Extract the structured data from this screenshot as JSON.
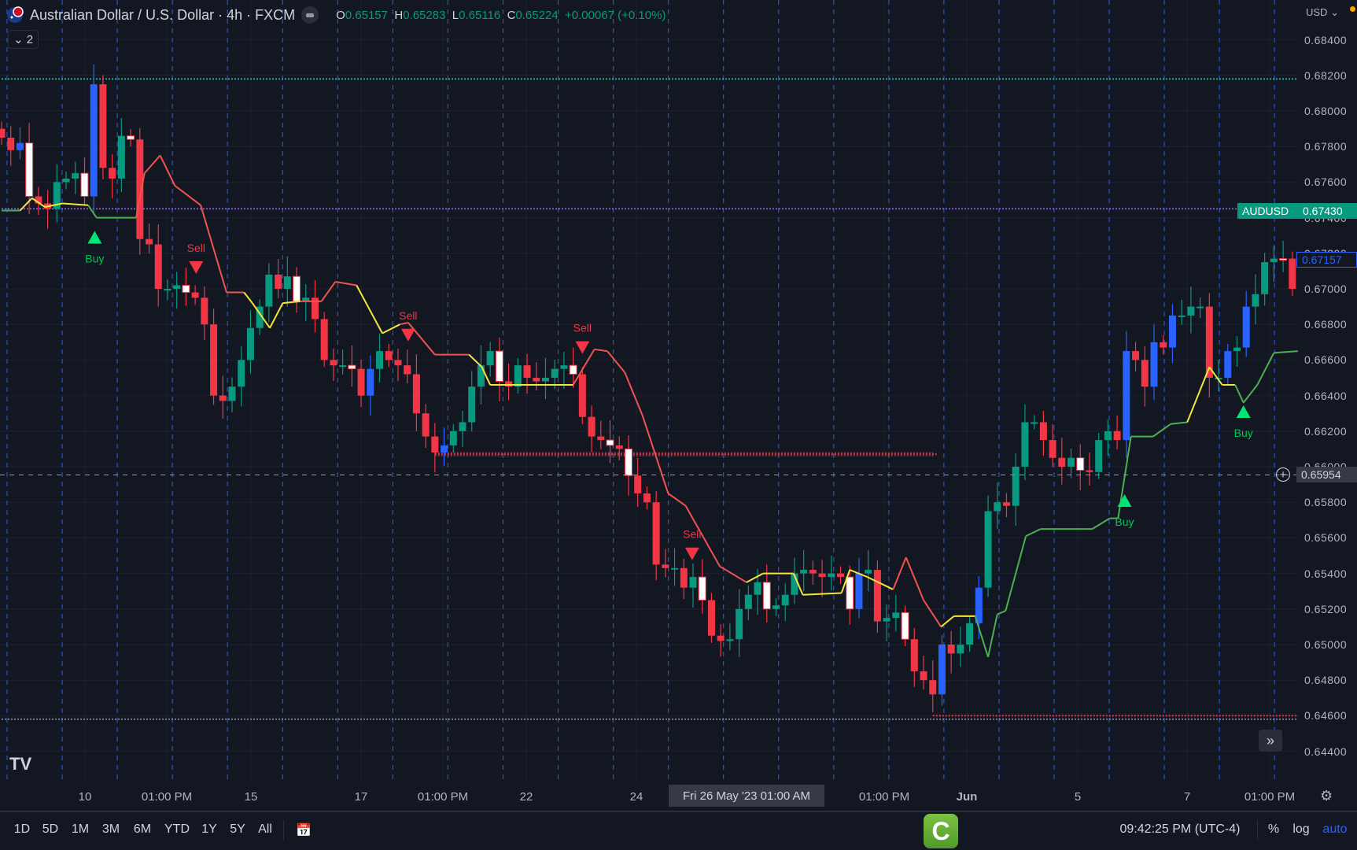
{
  "header": {
    "title": "Australian Dollar / U.S. Dollar · 4h · FXCM",
    "o_label": "O",
    "o": "0.65157",
    "h_label": "H",
    "h": "0.65283",
    "l_label": "L",
    "l": "0.65116",
    "c_label": "C",
    "c": "0.65224",
    "change": "+0.00067 (+0.10%)",
    "indicators_count": "2"
  },
  "axis": {
    "currency": "USD",
    "ticks": [
      "0.68400",
      "0.68200",
      "0.68000",
      "0.67800",
      "0.67600",
      "0.67400",
      "0.67200",
      "0.67000",
      "0.66800",
      "0.66600",
      "0.66400",
      "0.66200",
      "0.66000",
      "0.65800",
      "0.65600",
      "0.65400",
      "0.65200",
      "0.65000",
      "0.64800",
      "0.64600",
      "0.64400"
    ],
    "symbol_tag": "AUDUSD",
    "symbol_price": "0.67430",
    "last_price": "0.67157",
    "crosshair_price": "0.65954"
  },
  "time_labels": [
    "10",
    "01:00 PM",
    "15",
    "17",
    "01:00 PM",
    "22",
    "24",
    "01:00 PM",
    "Jun",
    "5",
    "7",
    "01:00 PM"
  ],
  "crosshair_time": "Fri 26 May '23  01:00 AM",
  "toolbar": {
    "ranges": [
      "1D",
      "5D",
      "1M",
      "3M",
      "6M",
      "YTD",
      "1Y",
      "5Y",
      "All"
    ],
    "clock": "09:42:25 PM (UTC-4)",
    "percent": "%",
    "log": "log",
    "auto": "auto",
    "center_logo": "C"
  },
  "logo": "17",
  "colors": {
    "bull": "#089981",
    "bear": "#f23645",
    "blue": "#2962ff",
    "white": "#ffffff",
    "trail_red": "#f05350",
    "trail_yellow": "#f5e63b",
    "trail_green": "#4caf50"
  },
  "chart_data": {
    "type": "candlestick",
    "start_open": 0.679,
    "closes": [
      [
        0.6785
      ],
      [
        0.6778
      ],
      [
        0.6782,
        "b"
      ],
      [
        0.6752,
        "w"
      ],
      [
        0.6748
      ],
      [
        0.6745
      ],
      [
        0.676
      ],
      [
        0.6762
      ],
      [
        0.6765
      ],
      [
        0.6752,
        "w"
      ],
      [
        0.6815,
        "b"
      ],
      [
        0.6768
      ],
      [
        0.6762
      ],
      [
        0.6786
      ],
      [
        0.6784,
        "w"
      ],
      [
        0.6728
      ],
      [
        0.6725
      ],
      [
        0.67
      ],
      [
        0.67
      ],
      [
        0.6702
      ],
      [
        0.6698,
        "w"
      ],
      [
        0.6695
      ],
      [
        0.668
      ],
      [
        0.664
      ],
      [
        0.6637
      ],
      [
        0.6645
      ],
      [
        0.666
      ],
      [
        0.6678
      ],
      [
        0.669
      ],
      [
        0.6708
      ],
      [
        0.67
      ],
      [
        0.6707
      ],
      [
        0.6693,
        "w"
      ],
      [
        0.6695
      ],
      [
        0.6683
      ],
      [
        0.666
      ],
      [
        0.6657
      ],
      [
        0.6657
      ],
      [
        0.6655,
        "w"
      ],
      [
        0.664
      ],
      [
        0.6655,
        "b"
      ],
      [
        0.6665
      ],
      [
        0.666
      ],
      [
        0.6657
      ],
      [
        0.6652
      ],
      [
        0.663
      ],
      [
        0.6617
      ],
      [
        0.6608
      ],
      [
        0.6612,
        "b"
      ],
      [
        0.662
      ],
      [
        0.6625
      ],
      [
        0.6645
      ],
      [
        0.6657
      ],
      [
        0.6665
      ],
      [
        0.6648,
        "w"
      ],
      [
        0.6645
      ],
      [
        0.6657
      ],
      [
        0.665
      ],
      [
        0.6648
      ],
      [
        0.665
      ],
      [
        0.6655
      ],
      [
        0.6657
      ],
      [
        0.6652,
        "w"
      ],
      [
        0.6628
      ],
      [
        0.6617
      ],
      [
        0.6615
      ],
      [
        0.6612,
        "w"
      ],
      [
        0.661
      ],
      [
        0.6595,
        "w"
      ],
      [
        0.6585
      ],
      [
        0.658
      ],
      [
        0.6545
      ],
      [
        0.6543
      ],
      [
        0.6543
      ],
      [
        0.6532
      ],
      [
        0.6538
      ],
      [
        0.6525,
        "w"
      ],
      [
        0.6505
      ],
      [
        0.6502
      ],
      [
        0.6503
      ],
      [
        0.652
      ],
      [
        0.6528
      ],
      [
        0.6535
      ],
      [
        0.652,
        "w"
      ],
      [
        0.6522
      ],
      [
        0.6528
      ],
      [
        0.654
      ],
      [
        0.6542
      ],
      [
        0.654
      ],
      [
        0.6538
      ],
      [
        0.654
      ],
      [
        0.6538
      ],
      [
        0.652,
        "w"
      ],
      [
        0.654,
        "b"
      ],
      [
        0.6542
      ],
      [
        0.6513
      ],
      [
        0.6515
      ],
      [
        0.6518
      ],
      [
        0.6503,
        "w"
      ],
      [
        0.6485
      ],
      [
        0.648
      ],
      [
        0.6472
      ],
      [
        0.65,
        "b"
      ],
      [
        0.6495
      ],
      [
        0.65
      ],
      [
        0.6512
      ],
      [
        0.6532,
        "b"
      ],
      [
        0.6575
      ],
      [
        0.658
      ],
      [
        0.6578
      ],
      [
        0.66
      ],
      [
        0.6625
      ],
      [
        0.6625
      ],
      [
        0.6615
      ],
      [
        0.6605
      ],
      [
        0.66
      ],
      [
        0.6605
      ],
      [
        0.6598,
        "w"
      ],
      [
        0.6597
      ],
      [
        0.6615
      ],
      [
        0.662
      ],
      [
        0.6615
      ],
      [
        0.6665,
        "b"
      ],
      [
        0.666
      ],
      [
        0.6645
      ],
      [
        0.667,
        "b"
      ],
      [
        0.6667
      ],
      [
        0.6685,
        "b"
      ],
      [
        0.6685
      ],
      [
        0.669
      ],
      [
        0.669
      ],
      [
        0.665
      ],
      [
        0.665
      ],
      [
        0.6665,
        "b"
      ],
      [
        0.6667
      ],
      [
        0.669,
        "b"
      ],
      [
        0.6697
      ],
      [
        0.6715
      ],
      [
        0.6717
      ],
      [
        0.6717,
        "w"
      ],
      [
        0.67
      ],
      [
        0.67157,
        "b"
      ]
    ],
    "trail": [
      [
        0,
        0.6744,
        "g"
      ],
      [
        2,
        0.6744,
        "y"
      ],
      [
        3.3,
        0.6751,
        "y"
      ],
      [
        4.7,
        0.6746,
        "y"
      ],
      [
        6.6,
        0.6748,
        "y"
      ],
      [
        9.4,
        0.6747,
        "g"
      ],
      [
        10.3,
        0.674,
        "g"
      ],
      [
        14.6,
        0.674,
        "r"
      ],
      [
        15.5,
        0.6765,
        "r"
      ],
      [
        17.2,
        0.6775,
        "r"
      ],
      [
        18.8,
        0.6758,
        "r"
      ],
      [
        21.6,
        0.6747,
        "r"
      ],
      [
        24.4,
        0.6698,
        "r"
      ],
      [
        26.3,
        0.6698,
        "y"
      ],
      [
        27.2,
        0.6692,
        "y"
      ],
      [
        29.1,
        0.6678,
        "y"
      ],
      [
        30.5,
        0.6692,
        "y"
      ],
      [
        32.4,
        0.6693,
        "r"
      ],
      [
        34.7,
        0.6693,
        "r"
      ],
      [
        36.2,
        0.6704,
        "r"
      ],
      [
        38.5,
        0.6702,
        "y"
      ],
      [
        41.3,
        0.6675,
        "y"
      ],
      [
        43.2,
        0.668,
        "r"
      ],
      [
        44.1,
        0.6681,
        "r"
      ],
      [
        47,
        0.6663,
        "r"
      ],
      [
        50.7,
        0.6663,
        "y"
      ],
      [
        52.1,
        0.6656,
        "y"
      ],
      [
        53,
        0.6646,
        "y"
      ],
      [
        62,
        0.6646,
        "r"
      ],
      [
        64.3,
        0.6666,
        "r"
      ],
      [
        65.7,
        0.6665,
        "r"
      ],
      [
        67.6,
        0.6653,
        "r"
      ],
      [
        69.5,
        0.6629,
        "r"
      ],
      [
        72.3,
        0.6585,
        "r"
      ],
      [
        74.2,
        0.6578,
        "r"
      ],
      [
        77.9,
        0.6544,
        "r"
      ],
      [
        80.8,
        0.6535,
        "y"
      ],
      [
        82.6,
        0.654,
        "y"
      ],
      [
        85.9,
        0.654,
        "y"
      ],
      [
        86.9,
        0.6528,
        "y"
      ],
      [
        91.1,
        0.6529,
        "y"
      ],
      [
        92,
        0.6542,
        "y"
      ],
      [
        93.9,
        0.6538,
        "y"
      ],
      [
        96.7,
        0.6531,
        "r"
      ],
      [
        98.1,
        0.6549,
        "r"
      ],
      [
        100,
        0.6525,
        "r"
      ],
      [
        101.9,
        0.651,
        "y"
      ],
      [
        103.3,
        0.6516,
        "y"
      ],
      [
        105.6,
        0.6516,
        "g"
      ],
      [
        107,
        0.6493,
        "g"
      ],
      [
        108,
        0.6517,
        "g"
      ],
      [
        108.9,
        0.6519,
        "g"
      ],
      [
        111.1,
        0.6561,
        "g"
      ],
      [
        112.7,
        0.6565,
        "g"
      ],
      [
        118.3,
        0.6565,
        "g"
      ],
      [
        120.2,
        0.6571,
        "g"
      ],
      [
        121.1,
        0.6571,
        "g"
      ],
      [
        122.5,
        0.6617,
        "g"
      ],
      [
        124.9,
        0.6617,
        "g"
      ],
      [
        126.8,
        0.6624,
        "g"
      ],
      [
        128.6,
        0.6625,
        "y"
      ],
      [
        131,
        0.6656,
        "y"
      ],
      [
        132.4,
        0.6646,
        "y"
      ],
      [
        133.8,
        0.6646,
        "g"
      ],
      [
        134.7,
        0.6636,
        "g"
      ],
      [
        136.2,
        0.6646,
        "g"
      ],
      [
        138,
        0.6664,
        "g"
      ],
      [
        140.6,
        0.6665,
        "g"
      ]
    ],
    "signals": [
      {
        "type": "Buy",
        "bar": 10.1,
        "price": 0.6729
      },
      {
        "type": "Sell",
        "bar": 21.1,
        "price": 0.6712
      },
      {
        "type": "Sell",
        "bar": 44.1,
        "price": 0.6674
      },
      {
        "type": "Sell",
        "bar": 63,
        "price": 0.6667
      },
      {
        "type": "Sell",
        "bar": 74.9,
        "price": 0.6551
      },
      {
        "type": "Buy",
        "bar": 121.8,
        "price": 0.6581
      },
      {
        "type": "Buy",
        "bar": 134.7,
        "price": 0.6631
      }
    ],
    "levels": [
      {
        "price": 0.6818,
        "color": "#26a69a",
        "from": 0,
        "to": 140.6
      },
      {
        "price": 0.6745,
        "color": "#7e57c2",
        "from": 0,
        "to": 140.6
      },
      {
        "price": 0.6607,
        "color": "#f23645",
        "from": 47,
        "to": 101
      },
      {
        "price": 0.646,
        "color": "#f23645",
        "from": 101,
        "to": 140.6
      },
      {
        "price": 0.6458,
        "color": "#787b86",
        "from": 0,
        "to": 140.6
      }
    ],
    "ylim": [
      0.643,
      0.685
    ]
  }
}
